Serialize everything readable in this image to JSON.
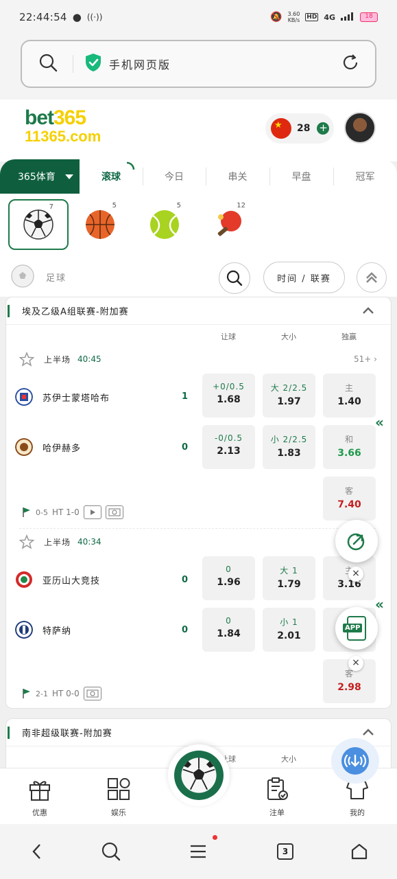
{
  "status_bar": {
    "time": "22:44:54",
    "net_speed_value": "3.60",
    "net_speed_unit": "KB/s",
    "hd": "HD",
    "network": "4G",
    "battery": "18"
  },
  "browser": {
    "url_label": "手机网页版"
  },
  "header": {
    "logo_line1_a": "bet",
    "logo_line1_b": "365",
    "logo_line2": "11365.com",
    "balance": "28"
  },
  "tabs": {
    "main": "365体育",
    "items": [
      {
        "label": "滚球",
        "active": true
      },
      {
        "label": "今日",
        "active": false
      },
      {
        "label": "串关",
        "active": false
      },
      {
        "label": "早盘",
        "active": false
      },
      {
        "label": "冠军",
        "active": false
      }
    ]
  },
  "sports": [
    {
      "name": "football-icon",
      "count": "7",
      "selected": true
    },
    {
      "name": "basketball-icon",
      "count": "5",
      "selected": false
    },
    {
      "name": "tennis-icon",
      "count": "5",
      "selected": false
    },
    {
      "name": "table-tennis-icon",
      "count": "12",
      "selected": false
    }
  ],
  "filter": {
    "sport_label": "足球",
    "sort_label": "时间 / 联赛"
  },
  "columns": {
    "handicap": "让球",
    "over_under": "大小",
    "moneyline": "独赢"
  },
  "leagues": [
    {
      "title": "埃及乙级A组联赛-附加赛",
      "matches": [
        {
          "period": "上半场",
          "clock": "40:45",
          "more": "51+",
          "home": {
            "name": "苏伊士蒙塔哈布",
            "score": "1"
          },
          "away": {
            "name": "哈伊赫多",
            "score": "0"
          },
          "handicap": [
            {
              "line": "+0/0.5",
              "odds": "1.68"
            },
            {
              "line": "-0/0.5",
              "odds": "2.13"
            }
          ],
          "totals": [
            {
              "line": "大 2/2.5",
              "odds": "1.97"
            },
            {
              "line": "小 2/2.5",
              "odds": "1.83"
            }
          ],
          "moneyline": [
            {
              "label": "主",
              "odds": "1.40"
            },
            {
              "label": "和",
              "odds": "3.66"
            },
            {
              "label": "客",
              "odds": "7.40"
            }
          ],
          "stats": {
            "corners": "0-5",
            "ht": "HT 1-0"
          }
        },
        {
          "period": "上半场",
          "clock": "40:34",
          "home": {
            "name": "亚历山大竞技",
            "score": "0"
          },
          "away": {
            "name": "特萨纳",
            "score": "0"
          },
          "handicap": [
            {
              "line": "0",
              "odds": "1.96"
            },
            {
              "line": "0",
              "odds": "1.84"
            }
          ],
          "totals": [
            {
              "line": "大 1",
              "odds": "1.79"
            },
            {
              "line": "小 1",
              "odds": "2.01"
            }
          ],
          "moneyline": [
            {
              "label": "主",
              "odds": "3.16"
            },
            {
              "label": "客",
              "odds": "2.98"
            }
          ],
          "stats": {
            "corners": "2-1",
            "ht": "HT 0-0"
          }
        }
      ]
    },
    {
      "title": "南非超级联赛-附加赛"
    }
  ],
  "floating": {
    "app_label": "APP"
  },
  "bottom_nav": [
    {
      "label": "优惠"
    },
    {
      "label": "娱乐"
    },
    {
      "label": "注单"
    },
    {
      "label": "我的"
    }
  ],
  "system_nav": {
    "tab_count": "3"
  },
  "colors": {
    "brand_green": "#0f5f3f",
    "accent_green": "#1e7a4a",
    "logo_yellow": "#f5d000",
    "odds_red": "#c51e1e"
  }
}
